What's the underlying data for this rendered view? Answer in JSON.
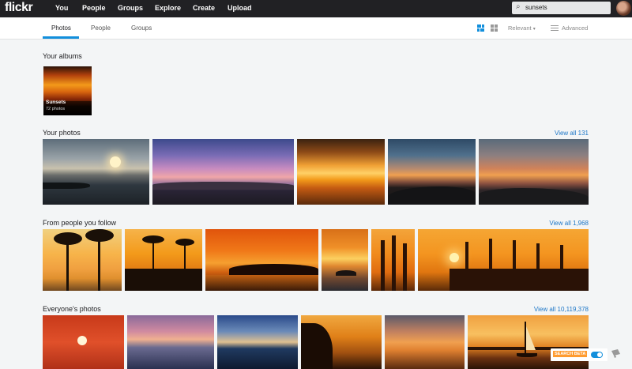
{
  "topnav": {
    "logo": "flickr",
    "items": [
      "You",
      "People",
      "Groups",
      "Explore",
      "Create",
      "Upload"
    ],
    "search_value": "sunsets"
  },
  "subnav": {
    "tabs": [
      "Photos",
      "People",
      "Groups"
    ],
    "active_tab": "Photos",
    "sort": "Relevant",
    "advanced": "Advanced"
  },
  "sections": {
    "albums_title": "Your albums",
    "album": {
      "title": "Sunsets",
      "count": "72 photos"
    },
    "your_photos": {
      "title": "Your photos",
      "view_all": "View all 131"
    },
    "following": {
      "title": "From people you follow",
      "view_all": "View all 1,968"
    },
    "everyone": {
      "title": "Everyone's photos",
      "view_all": "View all 10,119,378"
    }
  },
  "badge": {
    "label": "SEARCH BETA"
  },
  "colors": {
    "topbar": "#212124",
    "accent_blue": "#128fdc",
    "link_blue": "#1c76c7",
    "beta_orange": "#ff9b2f"
  },
  "icons": [
    "search-icon",
    "justified-view-icon",
    "grid-view-icon",
    "chevron-down-icon",
    "filter-icon",
    "feedback-icon"
  ]
}
